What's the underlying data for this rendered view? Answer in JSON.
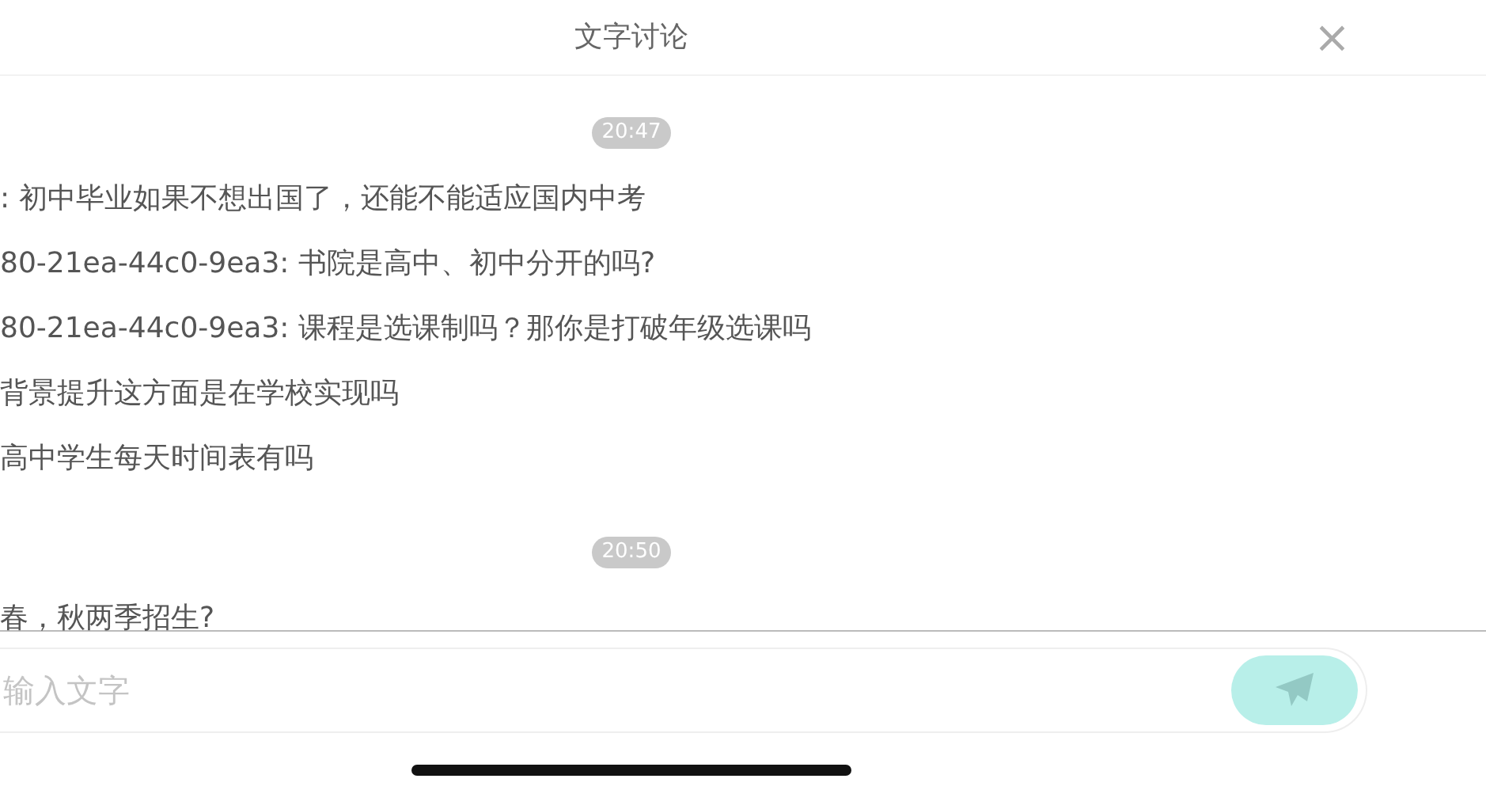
{
  "header": {
    "title": "文字讨论",
    "close": "×"
  },
  "messages": [
    {
      "kind": "time",
      "text": "20:47"
    },
    {
      "kind": "message",
      "text": ": 初中毕业如果不想出国了，还能不能适应国内中考"
    },
    {
      "kind": "message",
      "text": "80-21ea-44c0-9ea3: 书院是高中、初中分开的吗?"
    },
    {
      "kind": "message",
      "text": "80-21ea-44c0-9ea3: 课程是选课制吗？那你是打破年级选课吗"
    },
    {
      "kind": "message",
      "text": "背景提升这方面是在学校实现吗"
    },
    {
      "kind": "message",
      "text": "高中学生每天时间表有吗"
    },
    {
      "kind": "time",
      "text": "20:50"
    },
    {
      "kind": "message",
      "text": "春，秋两季招生?"
    }
  ],
  "composer": {
    "placeholder": "输入文字"
  }
}
